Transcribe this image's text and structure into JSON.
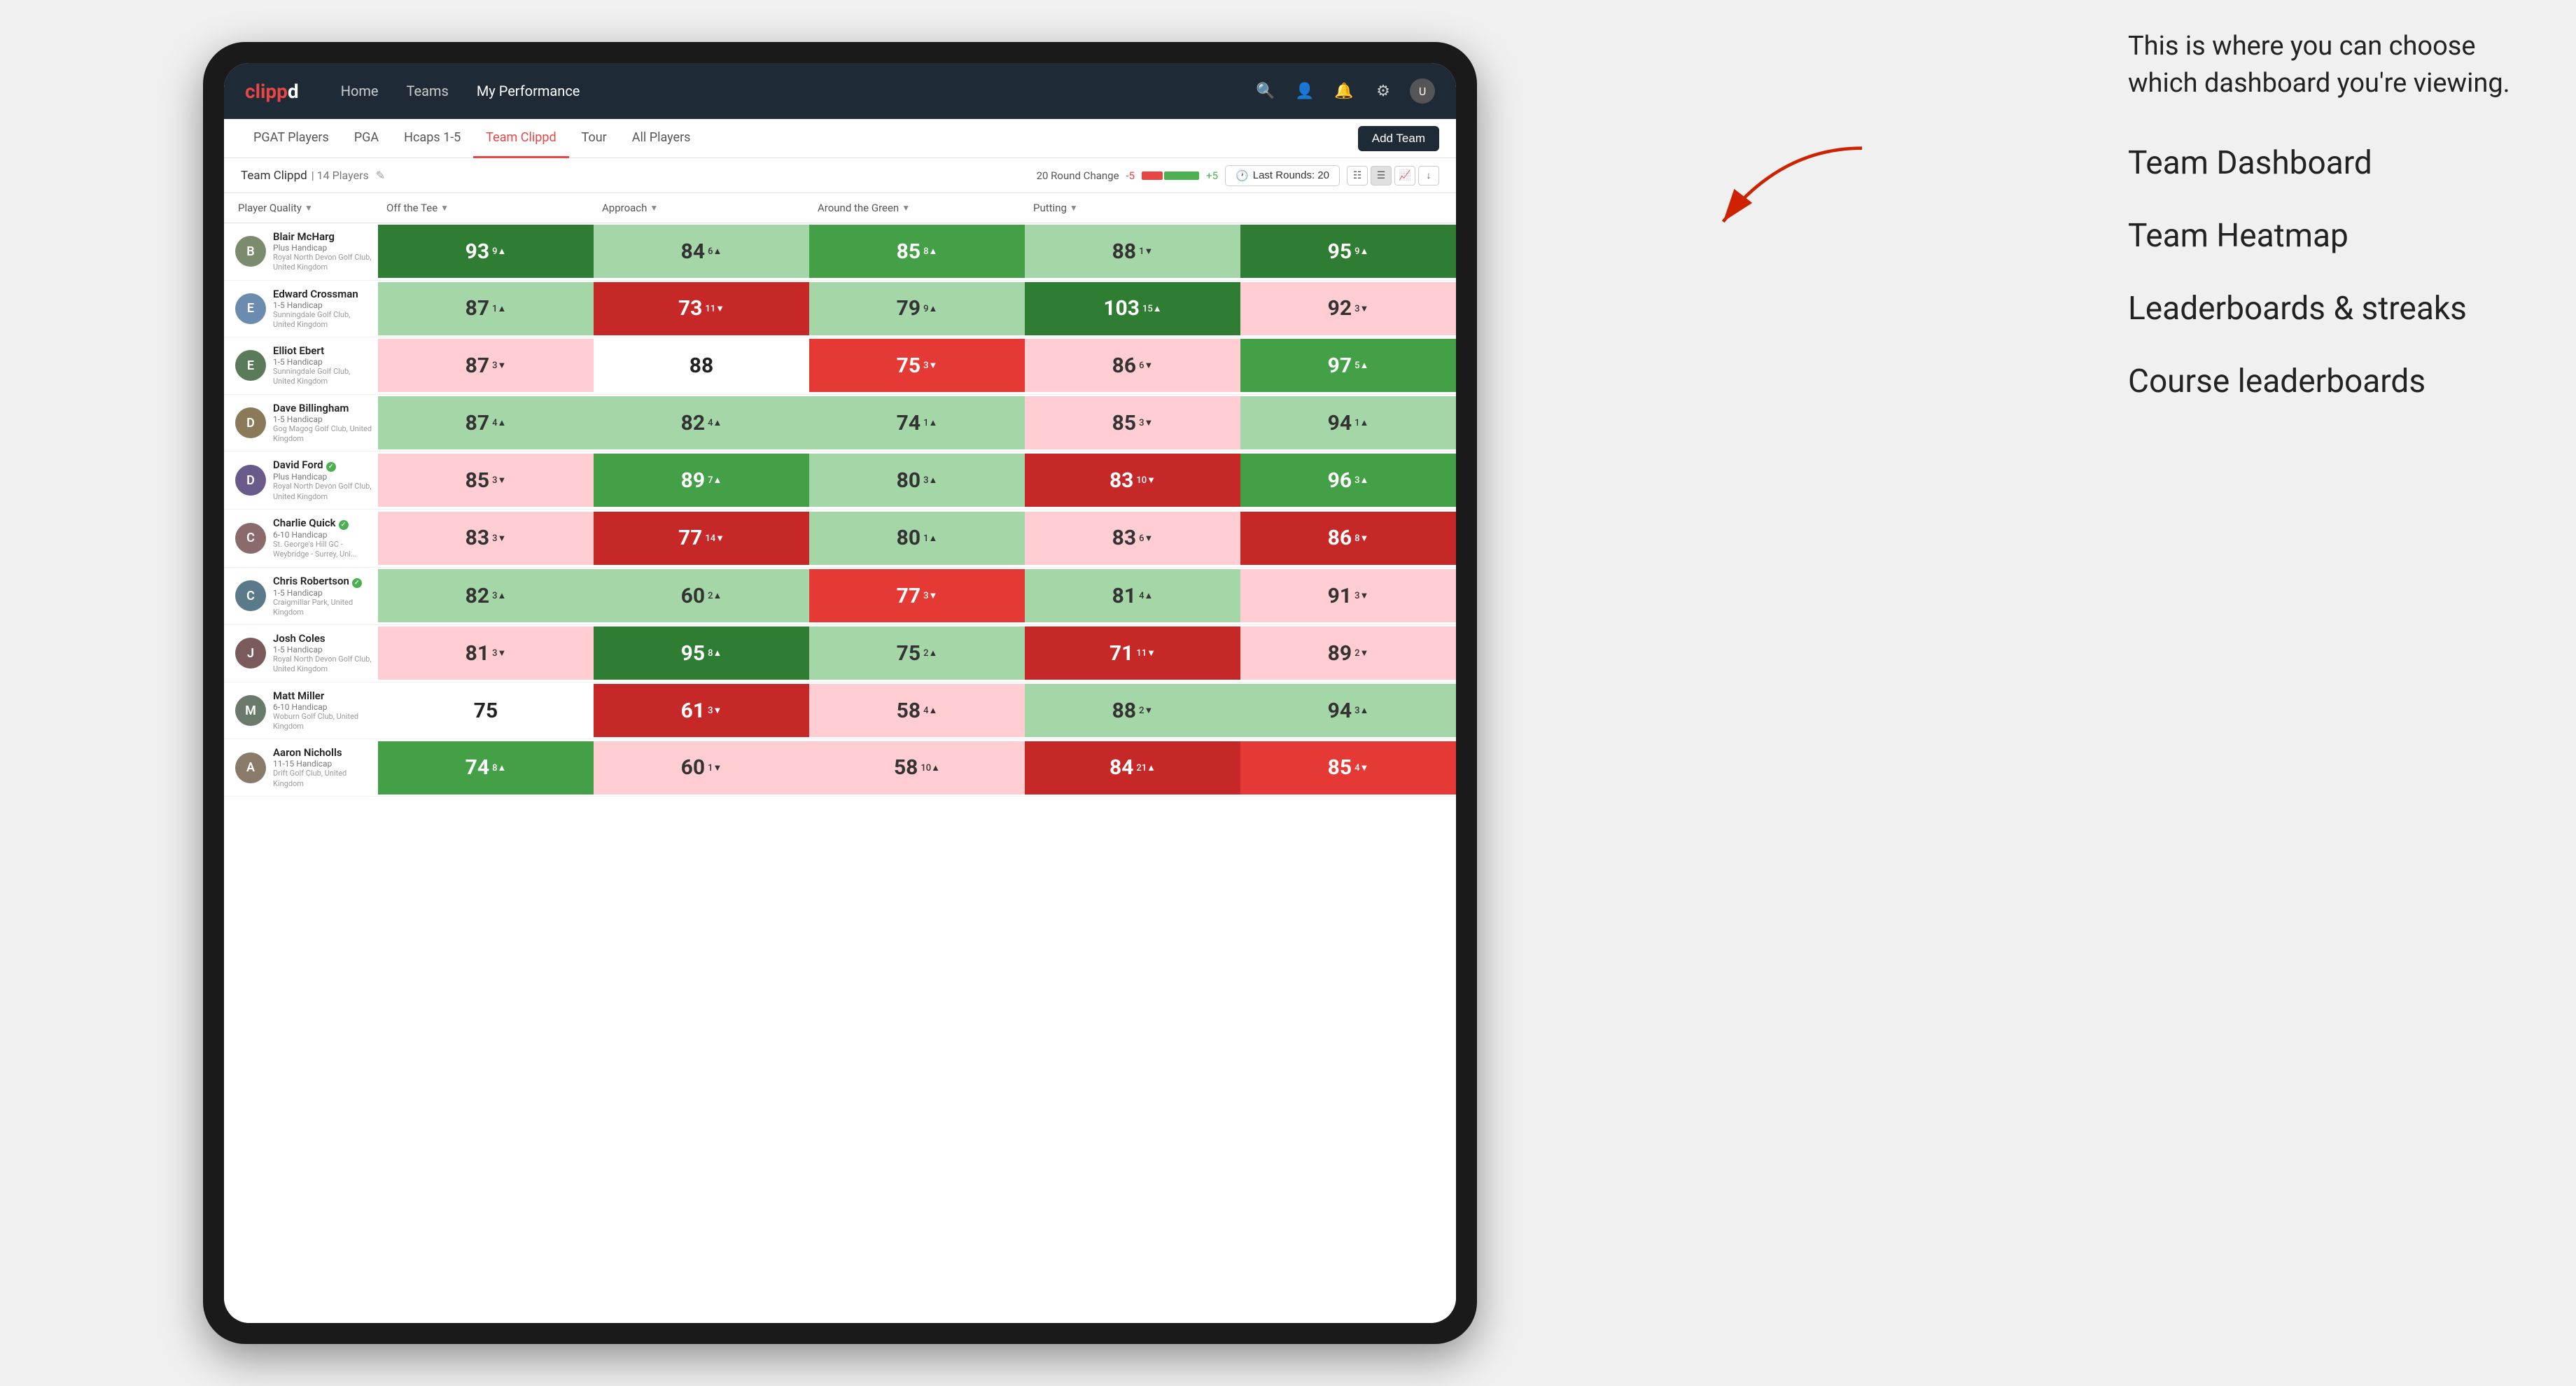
{
  "annotation": {
    "intro_text": "This is where you can choose which dashboard you're viewing.",
    "options": [
      "Team Dashboard",
      "Team Heatmap",
      "Leaderboards & streaks",
      "Course leaderboards"
    ]
  },
  "nav": {
    "logo": "clippd",
    "links": [
      "Home",
      "Teams",
      "My Performance"
    ],
    "active_link": "My Performance"
  },
  "sub_nav": {
    "links": [
      "PGAT Players",
      "PGA",
      "Hcaps 1-5",
      "Team Clippd",
      "Tour",
      "All Players"
    ],
    "active_link": "Team Clippd",
    "add_team_label": "Add Team"
  },
  "team_header": {
    "name": "Team Clippd",
    "separator": "|",
    "count": "14 Players",
    "round_change_label": "20 Round Change",
    "neg_value": "-5",
    "pos_value": "+5",
    "last_rounds_label": "Last Rounds:",
    "last_rounds_value": "20"
  },
  "col_headers": [
    "Player Quality ▼",
    "Off the Tee ▼",
    "Approach ▼",
    "Around the Green ▼",
    "Putting ▼"
  ],
  "players": [
    {
      "name": "Blair McHarg",
      "badge": "Plus Handicap",
      "club": "Royal North Devon Golf Club, United Kingdom",
      "avatar_letter": "B",
      "avatar_color": "#7b8c6e",
      "scores": [
        {
          "value": "93",
          "change": "9",
          "dir": "up",
          "color": "green-dark"
        },
        {
          "value": "84",
          "change": "6",
          "dir": "up",
          "color": "green-light"
        },
        {
          "value": "85",
          "change": "8",
          "dir": "up",
          "color": "green-mid"
        },
        {
          "value": "88",
          "change": "1",
          "dir": "down",
          "color": "green-light"
        },
        {
          "value": "95",
          "change": "9",
          "dir": "up",
          "color": "green-dark"
        }
      ]
    },
    {
      "name": "Edward Crossman",
      "badge": "1-5 Handicap",
      "club": "Sunningdale Golf Club, United Kingdom",
      "avatar_letter": "E",
      "avatar_color": "#6b8cae",
      "scores": [
        {
          "value": "87",
          "change": "1",
          "dir": "up",
          "color": "green-light"
        },
        {
          "value": "73",
          "change": "11",
          "dir": "down",
          "color": "red-dark"
        },
        {
          "value": "79",
          "change": "9",
          "dir": "up",
          "color": "green-light"
        },
        {
          "value": "103",
          "change": "15",
          "dir": "up",
          "color": "green-dark"
        },
        {
          "value": "92",
          "change": "3",
          "dir": "down",
          "color": "red-light"
        }
      ]
    },
    {
      "name": "Elliot Ebert",
      "badge": "1-5 Handicap",
      "club": "Sunningdale Golf Club, United Kingdom",
      "avatar_letter": "E",
      "avatar_color": "#5a7a5a",
      "scores": [
        {
          "value": "87",
          "change": "3",
          "dir": "down",
          "color": "red-light"
        },
        {
          "value": "88",
          "change": "",
          "dir": "",
          "color": "white-bg"
        },
        {
          "value": "75",
          "change": "3",
          "dir": "down",
          "color": "red-mid"
        },
        {
          "value": "86",
          "change": "6",
          "dir": "down",
          "color": "red-light"
        },
        {
          "value": "97",
          "change": "5",
          "dir": "up",
          "color": "green-mid"
        }
      ]
    },
    {
      "name": "Dave Billingham",
      "badge": "1-5 Handicap",
      "club": "Gog Magog Golf Club, United Kingdom",
      "avatar_letter": "D",
      "avatar_color": "#8a7a5a",
      "scores": [
        {
          "value": "87",
          "change": "4",
          "dir": "up",
          "color": "green-light"
        },
        {
          "value": "82",
          "change": "4",
          "dir": "up",
          "color": "green-light"
        },
        {
          "value": "74",
          "change": "1",
          "dir": "up",
          "color": "green-light"
        },
        {
          "value": "85",
          "change": "3",
          "dir": "down",
          "color": "red-light"
        },
        {
          "value": "94",
          "change": "1",
          "dir": "up",
          "color": "green-light"
        }
      ]
    },
    {
      "name": "David Ford",
      "badge": "Plus Handicap",
      "club": "Royal North Devon Golf Club, United Kingdom",
      "avatar_letter": "D",
      "avatar_color": "#6a5a8a",
      "verified": true,
      "scores": [
        {
          "value": "85",
          "change": "3",
          "dir": "down",
          "color": "red-light"
        },
        {
          "value": "89",
          "change": "7",
          "dir": "up",
          "color": "green-mid"
        },
        {
          "value": "80",
          "change": "3",
          "dir": "up",
          "color": "green-light"
        },
        {
          "value": "83",
          "change": "10",
          "dir": "down",
          "color": "red-dark"
        },
        {
          "value": "96",
          "change": "3",
          "dir": "up",
          "color": "green-mid"
        }
      ]
    },
    {
      "name": "Charlie Quick",
      "badge": "6-10 Handicap",
      "club": "St. George's Hill GC - Weybridge - Surrey, Uni...",
      "avatar_letter": "C",
      "avatar_color": "#8a6a6a",
      "verified": true,
      "scores": [
        {
          "value": "83",
          "change": "3",
          "dir": "down",
          "color": "red-light"
        },
        {
          "value": "77",
          "change": "14",
          "dir": "down",
          "color": "red-dark"
        },
        {
          "value": "80",
          "change": "1",
          "dir": "up",
          "color": "green-light"
        },
        {
          "value": "83",
          "change": "6",
          "dir": "down",
          "color": "red-light"
        },
        {
          "value": "86",
          "change": "8",
          "dir": "down",
          "color": "red-dark"
        }
      ]
    },
    {
      "name": "Chris Robertson",
      "badge": "1-5 Handicap",
      "club": "Craigmillar Park, United Kingdom",
      "avatar_letter": "C",
      "avatar_color": "#5a7a8a",
      "verified": true,
      "scores": [
        {
          "value": "82",
          "change": "3",
          "dir": "up",
          "color": "green-light"
        },
        {
          "value": "60",
          "change": "2",
          "dir": "up",
          "color": "green-light"
        },
        {
          "value": "77",
          "change": "3",
          "dir": "down",
          "color": "red-mid"
        },
        {
          "value": "81",
          "change": "4",
          "dir": "up",
          "color": "green-light"
        },
        {
          "value": "91",
          "change": "3",
          "dir": "down",
          "color": "red-light"
        }
      ]
    },
    {
      "name": "Josh Coles",
      "badge": "1-5 Handicap",
      "club": "Royal North Devon Golf Club, United Kingdom",
      "avatar_letter": "J",
      "avatar_color": "#7a5a5a",
      "scores": [
        {
          "value": "81",
          "change": "3",
          "dir": "down",
          "color": "red-light"
        },
        {
          "value": "95",
          "change": "8",
          "dir": "up",
          "color": "green-dark"
        },
        {
          "value": "75",
          "change": "2",
          "dir": "up",
          "color": "green-light"
        },
        {
          "value": "71",
          "change": "11",
          "dir": "down",
          "color": "red-dark"
        },
        {
          "value": "89",
          "change": "2",
          "dir": "down",
          "color": "red-light"
        }
      ]
    },
    {
      "name": "Matt Miller",
      "badge": "6-10 Handicap",
      "club": "Woburn Golf Club, United Kingdom",
      "avatar_letter": "M",
      "avatar_color": "#6a7a6a",
      "scores": [
        {
          "value": "75",
          "change": "",
          "dir": "",
          "color": "white-bg"
        },
        {
          "value": "61",
          "change": "3",
          "dir": "down",
          "color": "red-dark"
        },
        {
          "value": "58",
          "change": "4",
          "dir": "up",
          "color": "red-light"
        },
        {
          "value": "88",
          "change": "2",
          "dir": "down",
          "color": "green-light"
        },
        {
          "value": "94",
          "change": "3",
          "dir": "up",
          "color": "green-light"
        }
      ]
    },
    {
      "name": "Aaron Nicholls",
      "badge": "11-15 Handicap",
      "club": "Drift Golf Club, United Kingdom",
      "avatar_letter": "A",
      "avatar_color": "#8a7a6a",
      "scores": [
        {
          "value": "74",
          "change": "8",
          "dir": "up",
          "color": "green-mid"
        },
        {
          "value": "60",
          "change": "1",
          "dir": "down",
          "color": "red-light"
        },
        {
          "value": "58",
          "change": "10",
          "dir": "up",
          "color": "red-light"
        },
        {
          "value": "84",
          "change": "21",
          "dir": "up",
          "color": "red-dark"
        },
        {
          "value": "85",
          "change": "4",
          "dir": "down",
          "color": "red-mid"
        }
      ]
    }
  ]
}
